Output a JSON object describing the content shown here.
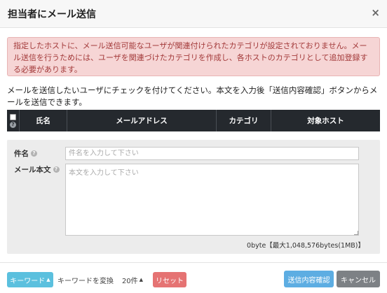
{
  "header": {
    "title": "担当者にメール送信",
    "close_label": "×"
  },
  "alert": {
    "text": "指定したホストに、メール送信可能なユーザが関連付けられたカテゴリが設定されておりません。メール送信を行うためには、ユーザを関連づけたカテゴリを作成し、各ホストのカテゴリとして追加登録する必要があります。"
  },
  "instruction": "メールを送信したいユーザにチェックを付けてください。本文を入力後「送信内容確認」ボタンからメールを送信できます。",
  "table": {
    "help_label": "?",
    "columns": [
      "氏名",
      "メールアドレス",
      "カテゴリ",
      "対象ホスト"
    ]
  },
  "form": {
    "help_label": "?",
    "subject_label": "件名",
    "subject_placeholder": "件名を入力して下さい",
    "body_label": "メール本文",
    "body_placeholder": "本文を入力して下さい",
    "byte_counter": "0byte【最大1,048,576bytes(1MB)】"
  },
  "footer": {
    "keyword_label": "キーワード",
    "convert_label": "キーワードを変換",
    "count_label": "20件",
    "reset_label": "リセット",
    "confirm_label": "送信内容確認",
    "cancel_label": "キャンセル",
    "caret": "▲"
  },
  "colors": {
    "table_header_bg": "#25292e",
    "alert_bg": "#f6d5d5",
    "alert_text": "#a33a3a",
    "keyword_btn": "#5bc0de",
    "reset_btn": "#e57373",
    "confirm_btn": "#5dade2",
    "cancel_btn": "#7d8185"
  }
}
